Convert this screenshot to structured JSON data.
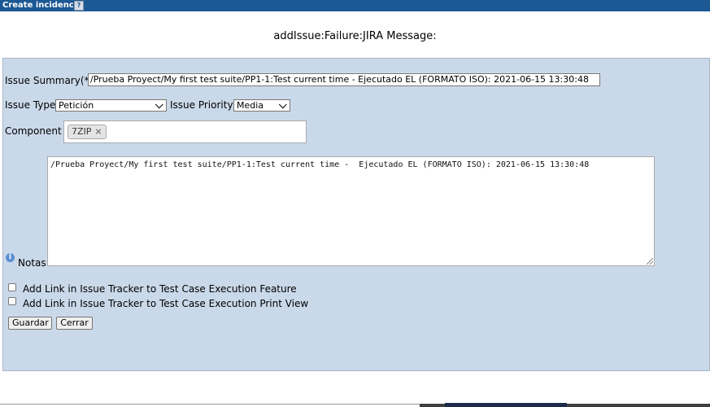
{
  "window": {
    "title": "Create incidencia",
    "help_icon": "?"
  },
  "heading": "addIssue:Failure:JIRA Message:",
  "form": {
    "summary_label": "Issue Summary(*)",
    "summary_value": "/Prueba Proyect/My first test suite/PP1-1:Test current time -  Ejecutado EL (FORMATO ISO): 2021-06-15 13:30:48",
    "type_label": "Issue Type",
    "type_value": "Petición",
    "priority_label": "Issue Priority",
    "priority_value": "Media",
    "component_label": "Component",
    "component_tag": "7ZIP",
    "component_tag_remove": "×",
    "notes_label": "Notas",
    "notes_icon": "i",
    "notes_value": "/Prueba Proyect/My first test suite/PP1-1:Test current time -  Ejecutado EL (FORMATO ISO): 2021-06-15 13:30:48",
    "checkbox_feature_label": "Add Link in Issue Tracker to Test Case Execution Feature",
    "checkbox_print_label": "Add Link in Issue Tracker to Test Case Execution Print View",
    "save_button": "Guardar",
    "cancel_button": "Cerrar"
  },
  "colors": {
    "titlebar": "#1c5894",
    "panel": "#cad9ea"
  }
}
